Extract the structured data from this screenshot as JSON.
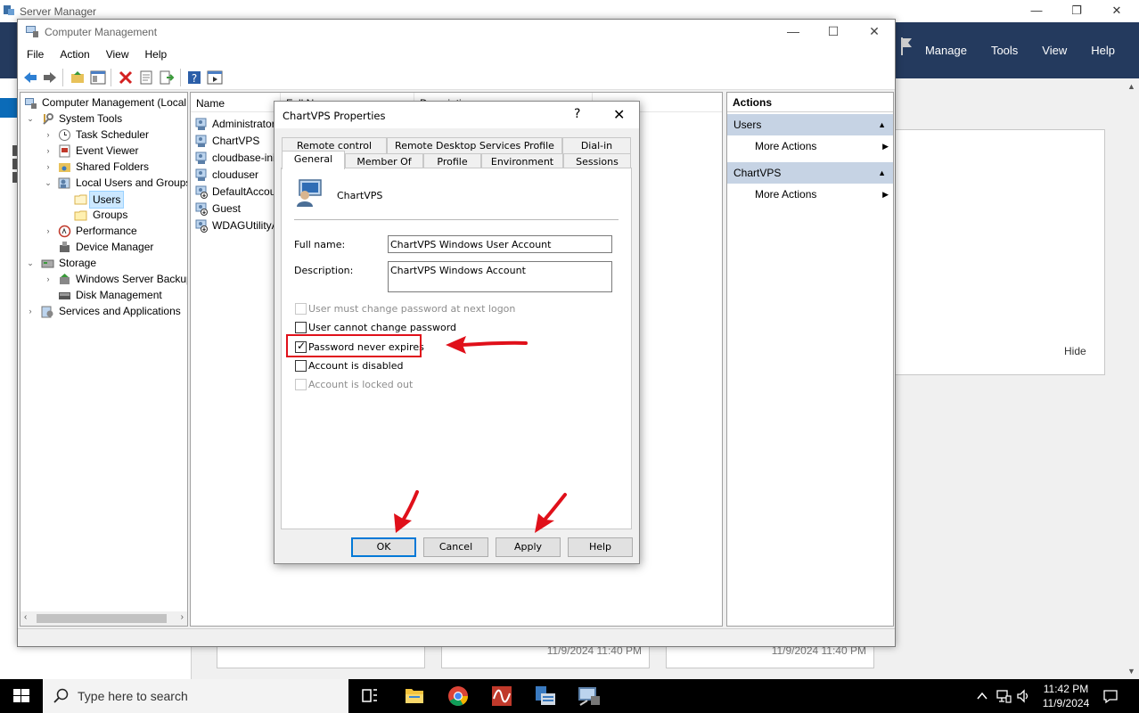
{
  "server_manager": {
    "title": "Server Manager",
    "menu": [
      "Manage",
      "Tools",
      "View",
      "Help"
    ],
    "tile_hide": "Hide",
    "card_timestamps": [
      "11/9/2024 11:40 PM",
      "11/9/2024 11:40 PM"
    ]
  },
  "comp_mgmt": {
    "title": "Computer Management",
    "menu": [
      "File",
      "Action",
      "View",
      "Help"
    ],
    "tree": [
      {
        "label": "Computer Management (Local",
        "icon": "computer-mgmt-icon"
      },
      {
        "label": "System Tools",
        "icon": "tools-icon"
      },
      {
        "label": "Task Scheduler",
        "icon": "clock-icon"
      },
      {
        "label": "Event Viewer",
        "icon": "event-viewer-icon"
      },
      {
        "label": "Shared Folders",
        "icon": "shared-folder-icon"
      },
      {
        "label": "Local Users and Groups",
        "icon": "users-groups-icon"
      },
      {
        "label": "Users",
        "icon": "folder-icon"
      },
      {
        "label": "Groups",
        "icon": "folder-icon"
      },
      {
        "label": "Performance",
        "icon": "performance-icon"
      },
      {
        "label": "Device Manager",
        "icon": "device-manager-icon"
      },
      {
        "label": "Storage",
        "icon": "storage-icon"
      },
      {
        "label": "Windows Server Backup",
        "icon": "backup-icon"
      },
      {
        "label": "Disk Management",
        "icon": "disk-icon"
      },
      {
        "label": "Services and Applications",
        "icon": "services-icon"
      }
    ],
    "list_columns": [
      "Name",
      "Full N",
      "Description"
    ],
    "users": [
      "Administrator",
      "ChartVPS",
      "cloudbase-init",
      "clouduser",
      "DefaultAccount",
      "Guest",
      "WDAGUtilityAccount"
    ],
    "actions": {
      "header": "Actions",
      "sections": [
        {
          "title": "Users",
          "item": "More Actions"
        },
        {
          "title": "ChartVPS",
          "item": "More Actions"
        }
      ]
    }
  },
  "dialog": {
    "title": "ChartVPS Properties",
    "help_glyph": "?",
    "close_glyph": "✕",
    "tabs_row1": [
      "Remote control",
      "Remote Desktop Services Profile",
      "Dial-in"
    ],
    "tabs_row2": [
      "General",
      "Member Of",
      "Profile",
      "Environment",
      "Sessions"
    ],
    "active_tab": "General",
    "username": "ChartVPS",
    "full_name_label": "Full name:",
    "full_name_value": "ChartVPS Windows User Account",
    "description_label": "Description:",
    "description_value": "ChartVPS Windows Account",
    "checkboxes": [
      {
        "label": "User must change password at next logon",
        "checked": false,
        "enabled": false
      },
      {
        "label": "User cannot change password",
        "checked": false,
        "enabled": true
      },
      {
        "label": "Password never expires",
        "checked": true,
        "enabled": true
      },
      {
        "label": "Account is disabled",
        "checked": false,
        "enabled": true
      },
      {
        "label": "Account is locked out",
        "checked": false,
        "enabled": false
      }
    ],
    "buttons": [
      "OK",
      "Cancel",
      "Apply",
      "Help"
    ]
  },
  "annotation_color": "#e0101a",
  "taskbar": {
    "search_placeholder": "Type here to search",
    "time": "11:42 PM",
    "date": "11/9/2024"
  }
}
